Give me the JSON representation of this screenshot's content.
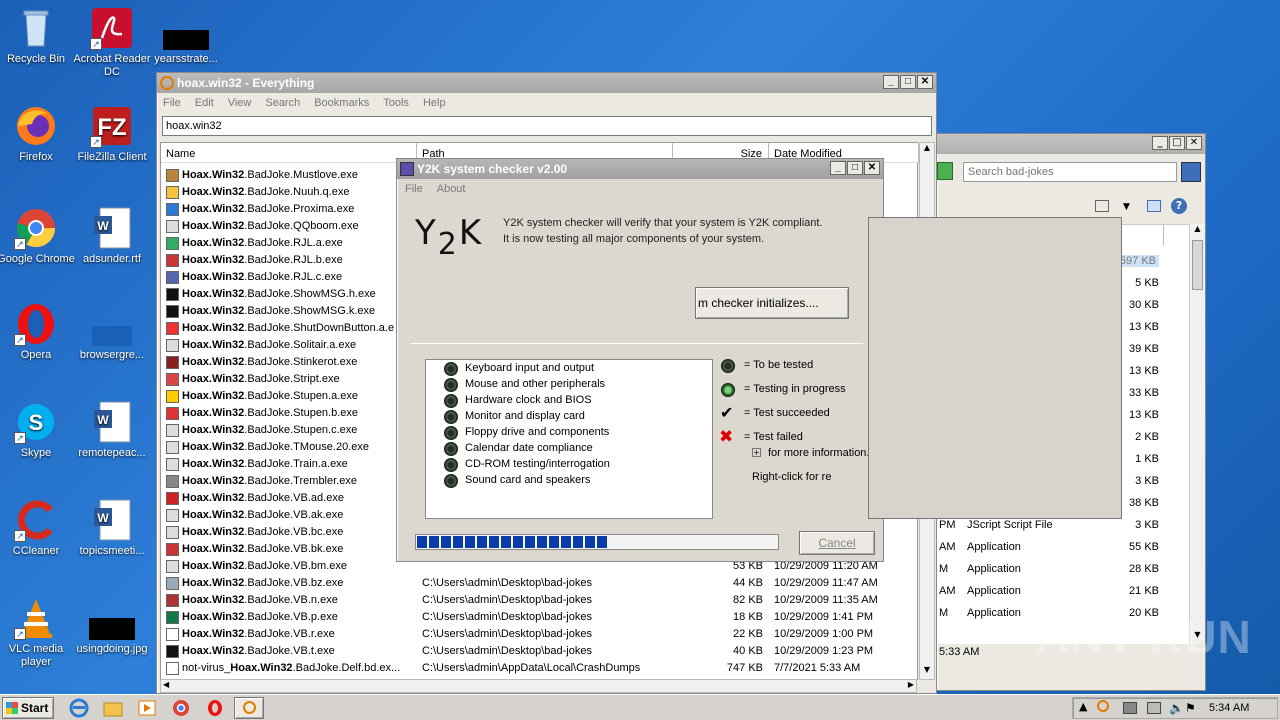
{
  "desktop": {
    "icons": [
      {
        "label": "Recycle Bin"
      },
      {
        "label": "Acrobat Reader DC"
      },
      {
        "label": "yearsstrate..."
      },
      {
        "label": "Firefox"
      },
      {
        "label": "FileZilla Client"
      },
      {
        "label": "Google Chrome"
      },
      {
        "label": "adsunder.rtf"
      },
      {
        "label": "Opera"
      },
      {
        "label": "browsergre..."
      },
      {
        "label": "Skype"
      },
      {
        "label": "remotepeac..."
      },
      {
        "label": "CCleaner"
      },
      {
        "label": "topicsmeeti..."
      },
      {
        "label": "VLC media player"
      },
      {
        "label": "usingdoing.jpg"
      }
    ]
  },
  "everything": {
    "title": "hoax.win32 - Everything",
    "menu": [
      "File",
      "Edit",
      "View",
      "Search",
      "Bookmarks",
      "Tools",
      "Help"
    ],
    "search_value": "hoax.win32",
    "columns": {
      "name": "Name",
      "path": "Path",
      "size": "Size",
      "date": "Date Modified"
    },
    "rows": [
      {
        "bold": "Hoax.Win32",
        "rest": ".BadJoke.Mustlove.exe",
        "path": "",
        "size": "",
        "date": ""
      },
      {
        "bold": "Hoax.Win32",
        "rest": ".BadJoke.Nuuh.q.exe",
        "path": "",
        "size": "",
        "date": ""
      },
      {
        "bold": "Hoax.Win32",
        "rest": ".BadJoke.Proxima.exe",
        "path": "",
        "size": "",
        "date": ""
      },
      {
        "bold": "Hoax.Win32",
        "rest": ".BadJoke.QQboom.exe",
        "path": "",
        "size": "",
        "date": ""
      },
      {
        "bold": "Hoax.Win32",
        "rest": ".BadJoke.RJL.a.exe",
        "path": "",
        "size": "",
        "date": ""
      },
      {
        "bold": "Hoax.Win32",
        "rest": ".BadJoke.RJL.b.exe",
        "path": "",
        "size": "",
        "date": ""
      },
      {
        "bold": "Hoax.Win32",
        "rest": ".BadJoke.RJL.c.exe",
        "path": "",
        "size": "",
        "date": ""
      },
      {
        "bold": "Hoax.Win32",
        "rest": ".BadJoke.ShowMSG.h.exe",
        "path": "",
        "size": "",
        "date": ""
      },
      {
        "bold": "Hoax.Win32",
        "rest": ".BadJoke.ShowMSG.k.exe",
        "path": "",
        "size": "",
        "date": ""
      },
      {
        "bold": "Hoax.Win32",
        "rest": ".BadJoke.ShutDownButton.a.e",
        "path": "",
        "size": "",
        "date": ""
      },
      {
        "bold": "Hoax.Win32",
        "rest": ".BadJoke.Solitair.a.exe",
        "path": "",
        "size": "",
        "date": ""
      },
      {
        "bold": "Hoax.Win32",
        "rest": ".BadJoke.Stinkerot.exe",
        "path": "",
        "size": "",
        "date": ""
      },
      {
        "bold": "Hoax.Win32",
        "rest": ".BadJoke.Stript.exe",
        "path": "",
        "size": "",
        "date": ""
      },
      {
        "bold": "Hoax.Win32",
        "rest": ".BadJoke.Stupen.a.exe",
        "path": "",
        "size": "",
        "date": ""
      },
      {
        "bold": "Hoax.Win32",
        "rest": ".BadJoke.Stupen.b.exe",
        "path": "",
        "size": "",
        "date": ""
      },
      {
        "bold": "Hoax.Win32",
        "rest": ".BadJoke.Stupen.c.exe",
        "path": "",
        "size": "",
        "date": ""
      },
      {
        "bold": "Hoax.Win32",
        "rest": ".BadJoke.TMouse.20.exe",
        "path": "",
        "size": "",
        "date": ""
      },
      {
        "bold": "Hoax.Win32",
        "rest": ".BadJoke.Train.a.exe",
        "path": "",
        "size": "",
        "date": ""
      },
      {
        "bold": "Hoax.Win32",
        "rest": ".BadJoke.Trembler.exe",
        "path": "",
        "size": "",
        "date": ""
      },
      {
        "bold": "Hoax.Win32",
        "rest": ".BadJoke.VB.ad.exe",
        "path": "",
        "size": "",
        "date": ""
      },
      {
        "bold": "Hoax.Win32",
        "rest": ".BadJoke.VB.ak.exe",
        "path": "",
        "size": "",
        "date": ""
      },
      {
        "bold": "Hoax.Win32",
        "rest": ".BadJoke.VB.bc.exe",
        "path": "",
        "size": "",
        "date": ""
      },
      {
        "bold": "Hoax.Win32",
        "rest": ".BadJoke.VB.bk.exe",
        "path": "",
        "size": "",
        "date": ""
      },
      {
        "bold": "Hoax.Win32",
        "rest": ".BadJoke.VB.bm.exe",
        "path": "",
        "size": "53 KB",
        "date": "10/29/2009 11:20 AM"
      },
      {
        "bold": "Hoax.Win32",
        "rest": ".BadJoke.VB.bz.exe",
        "path": "C:\\Users\\admin\\Desktop\\bad-jokes",
        "size": "44 KB",
        "date": "10/29/2009 11:47 AM"
      },
      {
        "bold": "Hoax.Win32",
        "rest": ".BadJoke.VB.n.exe",
        "path": "C:\\Users\\admin\\Desktop\\bad-jokes",
        "size": "82 KB",
        "date": "10/29/2009 11:35 AM"
      },
      {
        "bold": "Hoax.Win32",
        "rest": ".BadJoke.VB.p.exe",
        "path": "C:\\Users\\admin\\Desktop\\bad-jokes",
        "size": "18 KB",
        "date": "10/29/2009 1:41 PM"
      },
      {
        "bold": "Hoax.Win32",
        "rest": ".BadJoke.VB.r.exe",
        "path": "C:\\Users\\admin\\Desktop\\bad-jokes",
        "size": "22 KB",
        "date": "10/29/2009 1:00 PM"
      },
      {
        "bold": "Hoax.Win32",
        "rest": ".BadJoke.VB.t.exe",
        "path": "C:\\Users\\admin\\Desktop\\bad-jokes",
        "size": "40 KB",
        "date": "10/29/2009 1:23 PM"
      },
      {
        "prefix": "not-virus_",
        "bold": "Hoax.Win32",
        "rest": ".BadJoke.Delf.bd.ex...",
        "path": "C:\\Users\\admin\\AppData\\Local\\CrashDumps",
        "size": "747 KB",
        "date": "7/7/2021 5:33 AM"
      }
    ]
  },
  "explorer": {
    "search_placeholder": "Search bad-jokes",
    "sizes": [
      "597 KB",
      "5 KB",
      "30 KB",
      "13 KB",
      "39 KB",
      "13 KB",
      "33 KB",
      "13 KB",
      "2 KB",
      "1 KB",
      "3 KB",
      "38 KB",
      "3 KB",
      "55 KB",
      "28 KB",
      "21 KB",
      "20 KB"
    ],
    "types": [
      {
        "time": "PM",
        "type": "JScript Script File"
      },
      {
        "time": "AM",
        "type": "Application"
      },
      {
        "time": "M",
        "type": "Application"
      },
      {
        "time": "AM",
        "type": "Application"
      },
      {
        "time": "M",
        "type": "Application"
      }
    ],
    "status_time": "5:33 AM"
  },
  "y2k": {
    "title": "Y2K system checker v2.00",
    "menu": [
      "File",
      "About"
    ],
    "logo": {
      "y": "Y",
      "two": "2",
      "k": "K"
    },
    "intro_line1": "Y2K system checker will verify that your system is Y2K compliant.",
    "intro_line2": "It is now testing all major components of your system.",
    "status_button": "m checker initializes....",
    "tests": [
      "Keyboard input and output",
      "Mouse and other peripherals",
      "Hardware clock and BIOS",
      "Monitor and display card",
      "Floppy drive and components",
      "Calendar date compliance",
      "CD-ROM testing/interrogation",
      "Sound card and speakers"
    ],
    "legend": {
      "to_be_tested": "= To be tested",
      "in_progress": "= Testing in progress",
      "succeeded": "= Test succeeded",
      "failed": "= Test failed",
      "more_info": "for more information.",
      "right_click": "Right-click for re"
    },
    "progress_blocks": 16,
    "progress_total_blocks": 38,
    "cancel_label": "Cancel"
  },
  "taskbar": {
    "start_label": "Start",
    "clock": "5:34 AM"
  },
  "watermark": "ANY RUN"
}
